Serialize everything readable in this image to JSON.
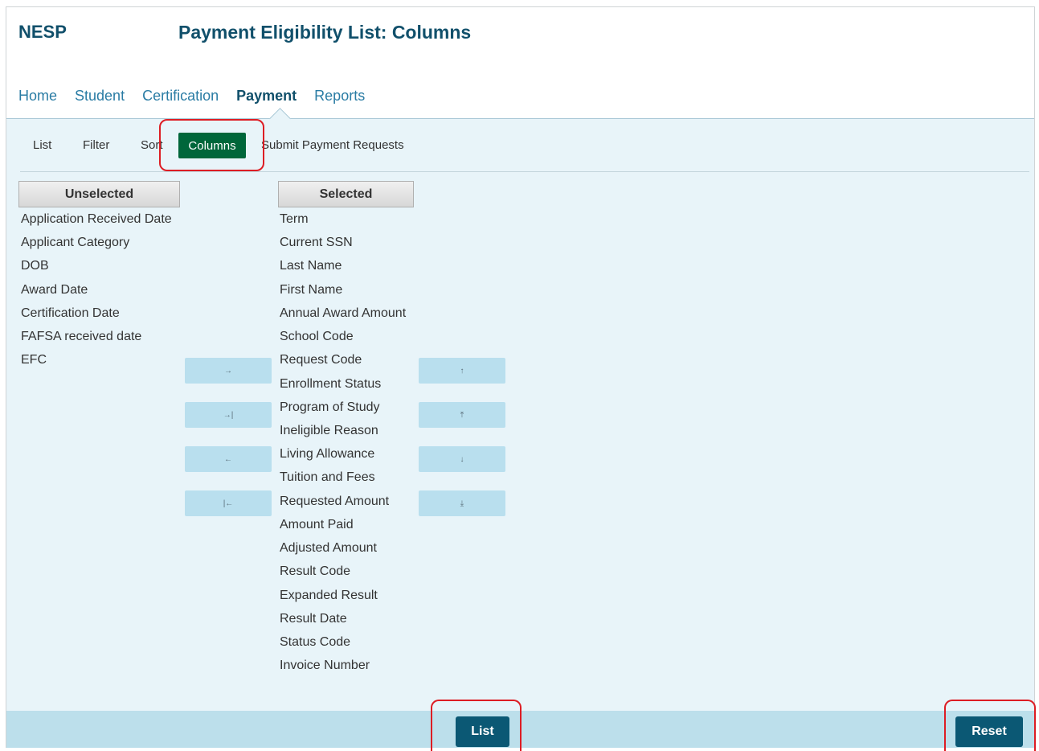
{
  "header": {
    "app_name": "NESP",
    "page_title": "Payment Eligibility List: Columns"
  },
  "nav": {
    "items": [
      {
        "label": "Home"
      },
      {
        "label": "Student"
      },
      {
        "label": "Certification"
      },
      {
        "label": "Payment",
        "active": true
      },
      {
        "label": "Reports"
      }
    ]
  },
  "subnav": {
    "list": "List",
    "filter": "Filter",
    "sort": "Sort",
    "columns": "Columns",
    "submit": "Submit Payment Requests"
  },
  "unselected": {
    "heading": "Unselected",
    "items": [
      "Application Received Date",
      "Applicant Category",
      "DOB",
      "Award Date",
      "Certification Date",
      "FAFSA received date",
      "EFC"
    ]
  },
  "selected": {
    "heading": "Selected",
    "items": [
      "Term",
      "Current SSN",
      "Last Name",
      "First Name",
      "Annual Award Amount",
      "School Code",
      "Request Code",
      "Enrollment Status",
      "Program of Study",
      "Ineligible Reason",
      "Living Allowance",
      "Tuition and Fees",
      "Requested Amount",
      "Amount Paid",
      "Adjusted Amount",
      "Result Code",
      "Expanded Result",
      "Result Date",
      "Status Code",
      "Invoice Number"
    ]
  },
  "move_buttons": {
    "add": "→",
    "add_all": "→|",
    "remove": "←",
    "remove_all": "|←"
  },
  "order_buttons": {
    "up": "↑",
    "top": "⤒",
    "down": "↓",
    "bottom": "⤓"
  },
  "footer": {
    "list_button": "List",
    "reset_button": "Reset"
  },
  "colors": {
    "brand": "#11506b",
    "active_tab": "#00663a",
    "panel_bg": "#e8f4f9",
    "footer_bg": "#bcdfeb",
    "primary_button": "#0b5874",
    "highlight": "#dd1d24"
  }
}
